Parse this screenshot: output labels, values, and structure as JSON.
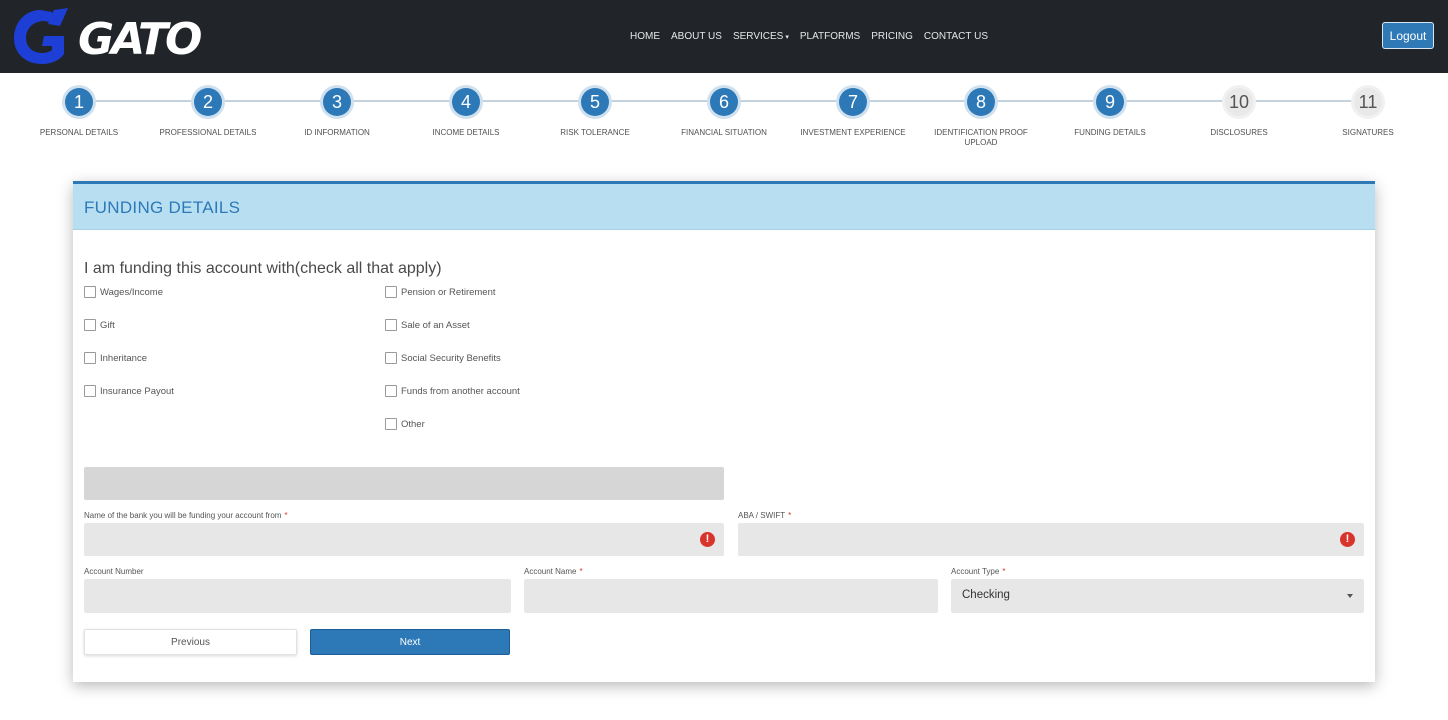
{
  "header": {
    "logo_text": "GATO",
    "nav": [
      {
        "label": "HOME"
      },
      {
        "label": "ABOUT US"
      },
      {
        "label": "SERVICES",
        "dropdown": true
      },
      {
        "label": "PLATFORMS"
      },
      {
        "label": "PRICING"
      },
      {
        "label": "CONTACT US"
      }
    ],
    "logout_label": "Logout"
  },
  "stepper": {
    "steps": [
      {
        "number": "1",
        "label": "PERSONAL DETAILS",
        "active": true
      },
      {
        "number": "2",
        "label": "PROFESSIONAL DETAILS",
        "active": true
      },
      {
        "number": "3",
        "label": "ID INFORMATION",
        "active": true
      },
      {
        "number": "4",
        "label": "INCOME DETAILS",
        "active": true
      },
      {
        "number": "5",
        "label": "RISK TOLERANCE",
        "active": true
      },
      {
        "number": "6",
        "label": "FINANCIAL SITUATION",
        "active": true
      },
      {
        "number": "7",
        "label": "INVESTMENT EXPERIENCE",
        "active": true
      },
      {
        "number": "8",
        "label": "IDENTIFICATION PROOF UPLOAD",
        "active": true
      },
      {
        "number": "9",
        "label": "FUNDING DETAILS",
        "active": true
      },
      {
        "number": "10",
        "label": "DISCLOSURES",
        "active": false
      },
      {
        "number": "11",
        "label": "SIGNATURES",
        "active": false
      }
    ]
  },
  "card": {
    "title": "FUNDING DETAILS",
    "question": "I am funding this account with(check all that apply)",
    "checkboxes_left": [
      "Wages/Income",
      "Gift",
      "Inheritance",
      "Insurance Payout"
    ],
    "checkboxes_right": [
      "Pension or Retirement",
      "Sale of an Asset",
      "Social Security Benefits",
      "Funds from another account",
      "Other"
    ],
    "fields": {
      "bank_name_label": "Name of the bank you will be funding your account from",
      "aba_swift_label": "ABA / SWIFT",
      "account_number_label": "Account Number",
      "account_name_label": "Account Name",
      "account_type_label": "Account Type",
      "account_type_value": "Checking",
      "required_mark": "*",
      "error_mark": "!"
    },
    "buttons": {
      "previous": "Previous",
      "next": "Next"
    }
  },
  "colors": {
    "accent": "#2d79b8",
    "header_bg": "#212529",
    "card_header_bg": "#b8dff1",
    "error": "#d9342b"
  }
}
